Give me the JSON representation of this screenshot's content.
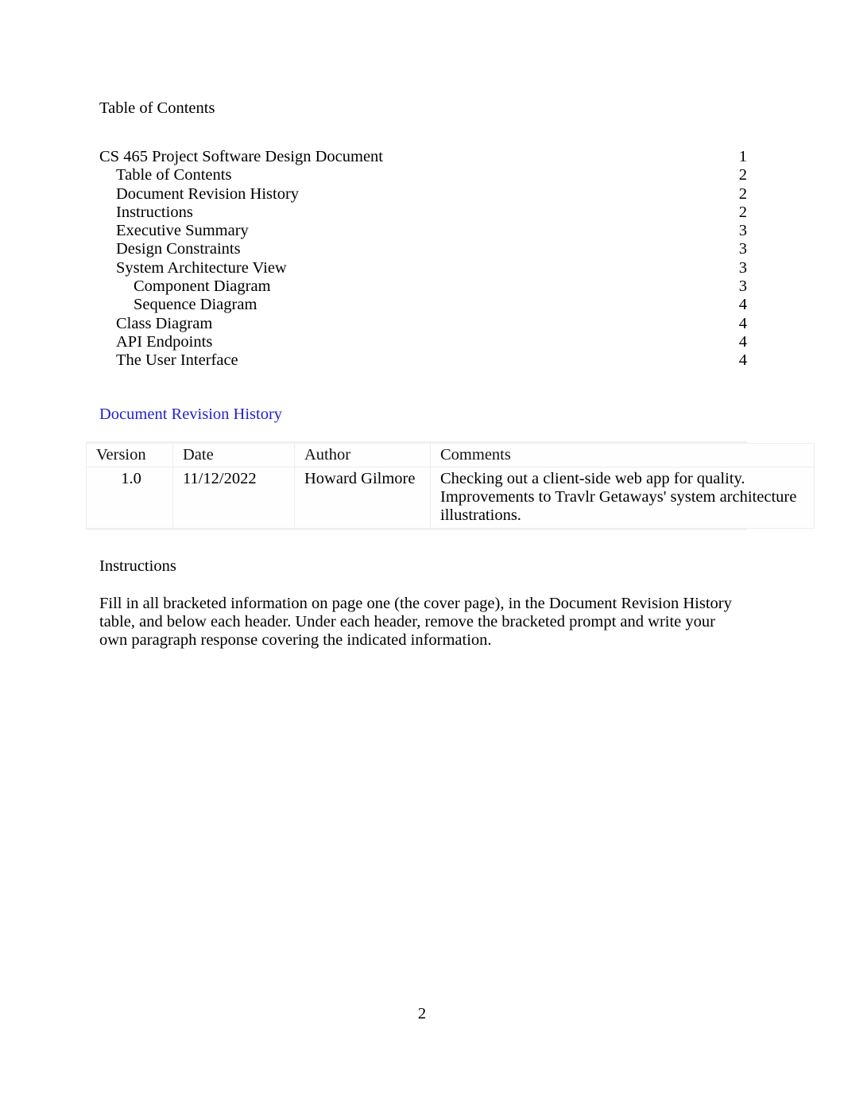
{
  "document": {
    "toc_heading": "Table of Contents",
    "footer_page_number": "2",
    "accent_heading_color": "#2222cc"
  },
  "toc": {
    "entries": [
      {
        "label": "CS 465 Project Software Design Document",
        "page": "1",
        "level": 0
      },
      {
        "label": "Table of Contents",
        "page": "2",
        "level": 1
      },
      {
        "label": "Document Revision History",
        "page": "2",
        "level": 1
      },
      {
        "label": "Instructions",
        "page": "2",
        "level": 1
      },
      {
        "label": "Executive Summary",
        "page": "3",
        "level": 1
      },
      {
        "label": "Design Constraints",
        "page": "3",
        "level": 1
      },
      {
        "label": "System Architecture View",
        "page": "3",
        "level": 1
      },
      {
        "label": "Component Diagram",
        "page": "3",
        "level": 2
      },
      {
        "label": "Sequence Diagram",
        "page": "4",
        "level": 2
      },
      {
        "label": "Class Diagram",
        "page": "4",
        "level": 1
      },
      {
        "label": "API Endpoints",
        "page": "4",
        "level": 1
      },
      {
        "label": "The User Interface",
        "page": "4",
        "level": 1
      }
    ]
  },
  "revision_history": {
    "heading": "Document Revision History",
    "columns": [
      "Version",
      "Date",
      "Author",
      "Comments"
    ],
    "rows": [
      {
        "version": "1.0",
        "date": "11/12/2022",
        "author": "Howard Gilmore",
        "comments": "Checking out a client-side web app for quality. Improvements to Travlr Getaways' system architecture illustrations."
      }
    ]
  },
  "instructions": {
    "heading": "Instructions",
    "paragraph": "Fill in all bracketed information on page one (the cover page), in the Document Revision History table, and below each header. Under each header, remove the bracketed prompt and write your own paragraph response covering the indicated information."
  }
}
